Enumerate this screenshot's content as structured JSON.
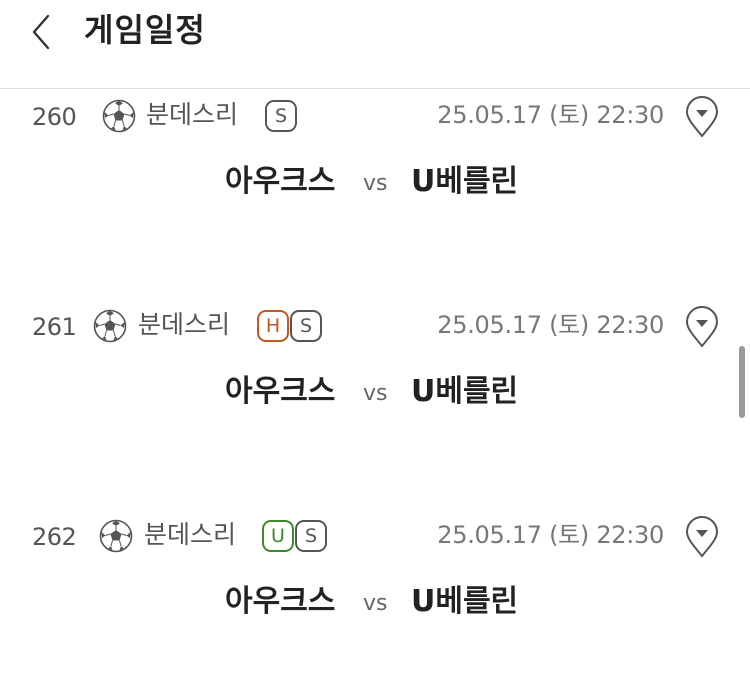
{
  "header": {
    "title": "게임일정",
    "back_icon": "chevron-left-icon"
  },
  "games": [
    {
      "number": "260",
      "sport_icon": "soccer-ball-icon",
      "league": "분데스리",
      "badges": [
        {
          "label": "S",
          "type": "s"
        }
      ],
      "datetime": "25.05.17 (토) 22:30",
      "home": "아우크스",
      "vs": "vs",
      "away": "U베를린"
    },
    {
      "number": "261",
      "sport_icon": "soccer-ball-icon",
      "league": "분데스리",
      "badges": [
        {
          "label": "H",
          "type": "h"
        },
        {
          "label": "S",
          "type": "s"
        }
      ],
      "datetime": "25.05.17 (토) 22:30",
      "home": "아우크스",
      "vs": "vs",
      "away": "U베를린"
    },
    {
      "number": "262",
      "sport_icon": "soccer-ball-icon",
      "league": "분데스리",
      "badges": [
        {
          "label": "U",
          "type": "u"
        },
        {
          "label": "S",
          "type": "s"
        }
      ],
      "datetime": "25.05.17 (토) 22:30",
      "home": "아우크스",
      "vs": "vs",
      "away": "U베를린"
    }
  ],
  "colors": {
    "badge_h": "#c0581f",
    "badge_u": "#3d8a2a",
    "badge_s": "#555555",
    "divider": "#dcdcdc"
  }
}
